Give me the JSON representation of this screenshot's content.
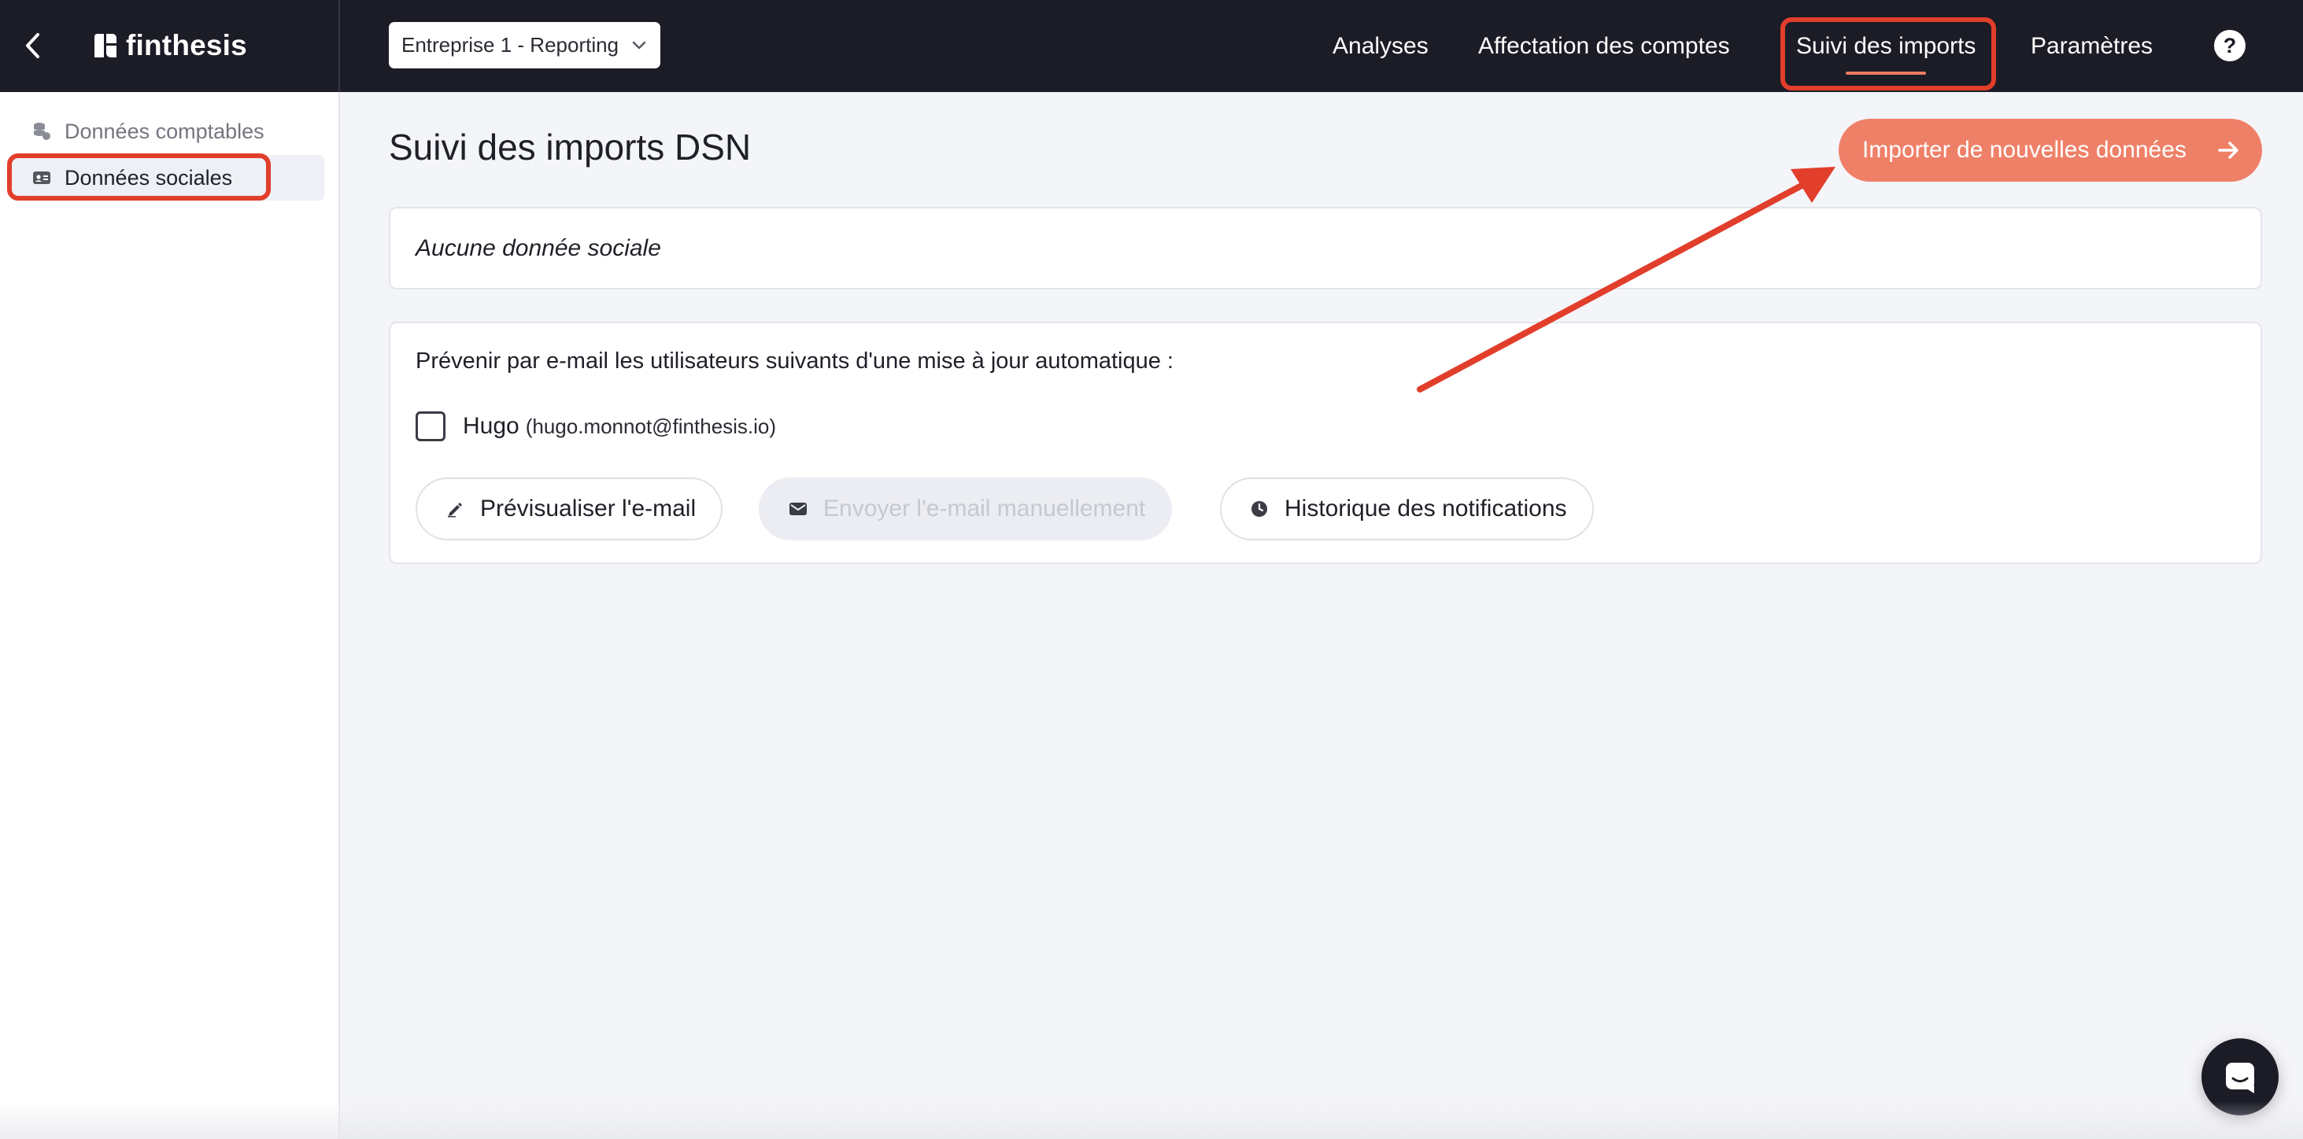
{
  "header": {
    "back_icon": "chevron-left-icon",
    "logo_text": "finthesis",
    "company_select": {
      "value": "Entreprise 1 - Reporting",
      "icon": "chevron-down-icon"
    },
    "nav": [
      {
        "label": "Analyses",
        "active": false
      },
      {
        "label": "Affectation des comptes",
        "active": false
      },
      {
        "label": "Suivi des imports",
        "active": true
      },
      {
        "label": "Paramètres",
        "active": false
      }
    ],
    "help_label": "?",
    "accent_color": "#ee7b63",
    "background_color": "#1b1c26"
  },
  "sidebar": {
    "items": [
      {
        "label": "Données comptables",
        "icon": "database-icon",
        "active": false
      },
      {
        "label": "Données sociales",
        "icon": "id-card-icon",
        "active": true
      }
    ]
  },
  "main": {
    "title": "Suivi des imports DSN",
    "import_button": {
      "label": "Importer de nouvelles données",
      "icon": "arrow-right-icon",
      "color": "#ef8068"
    },
    "empty_message": "Aucune donnée sociale",
    "notify": {
      "text": "Prévenir par e-mail les utilisateurs suivants d'une mise à jour automatique :",
      "users": [
        {
          "name": "Hugo",
          "email": "(hugo.monnot@finthesis.io)",
          "checked": false
        }
      ],
      "buttons": [
        {
          "label": "Prévisualiser l'e-mail",
          "icon": "pencil-icon",
          "disabled": false
        },
        {
          "label": "Envoyer l'e-mail manuellement",
          "icon": "envelope-icon",
          "disabled": true
        },
        {
          "label": "Historique des notifications",
          "icon": "clock-icon",
          "disabled": false
        }
      ]
    }
  },
  "annotations": {
    "highlight_color": "#e13e2b"
  },
  "chat": {
    "icon": "chat-icon"
  }
}
